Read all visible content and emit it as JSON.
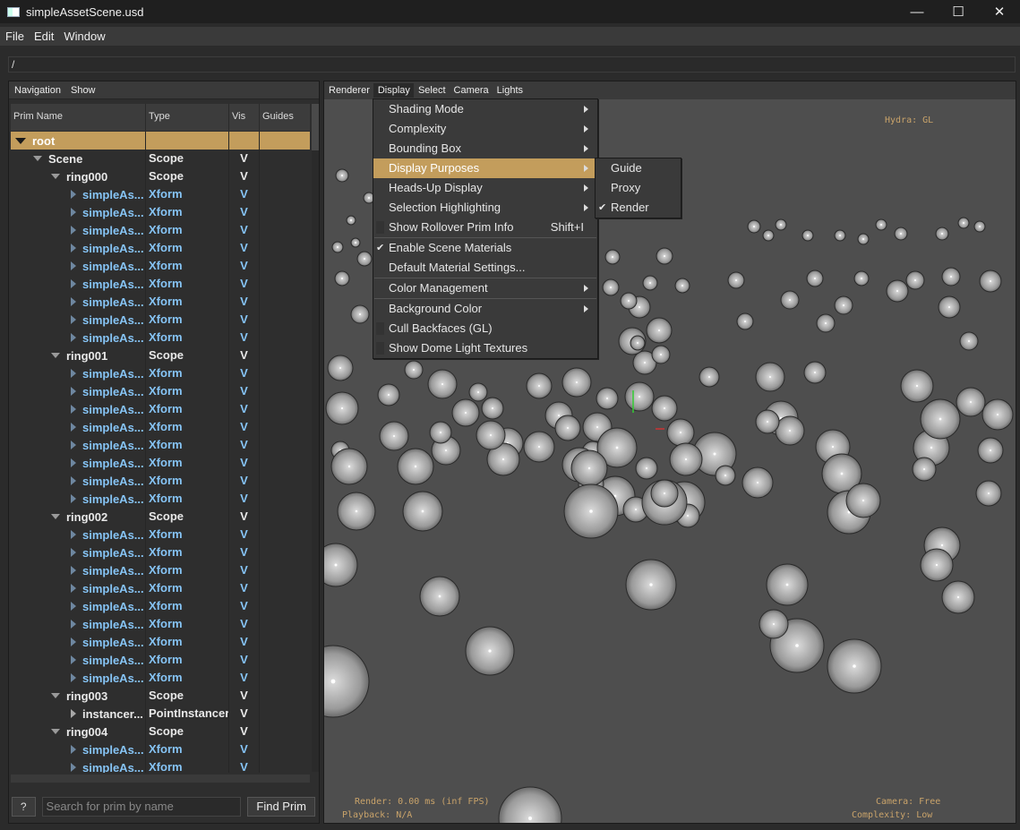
{
  "window": {
    "title": "simpleAssetScene.usd",
    "minimize": "—",
    "maximize": "☐",
    "close": "✕"
  },
  "menubar": [
    "File",
    "Edit",
    "Window"
  ],
  "path": "/",
  "left_menu": [
    "Navigation",
    "Show"
  ],
  "columns": [
    "Prim Name",
    "Type",
    "Vis",
    "Guides"
  ],
  "rows": [
    {
      "name": "root",
      "type": "",
      "vis": "",
      "level": 0,
      "expander": "down",
      "style": "sel"
    },
    {
      "name": "Scene",
      "type": "Scope",
      "vis": "V",
      "level": 1,
      "expander": "down",
      "style": "plain"
    },
    {
      "name": "ring000",
      "type": "Scope",
      "vis": "V",
      "level": 2,
      "expander": "down",
      "style": "plain"
    },
    {
      "name": "simpleAs...",
      "type": "Xform",
      "vis": "V",
      "level": 3,
      "expander": "right",
      "style": "xf"
    },
    {
      "name": "simpleAs...",
      "type": "Xform",
      "vis": "V",
      "level": 3,
      "expander": "right",
      "style": "xf"
    },
    {
      "name": "simpleAs...",
      "type": "Xform",
      "vis": "V",
      "level": 3,
      "expander": "right",
      "style": "xf"
    },
    {
      "name": "simpleAs...",
      "type": "Xform",
      "vis": "V",
      "level": 3,
      "expander": "right",
      "style": "xf"
    },
    {
      "name": "simpleAs...",
      "type": "Xform",
      "vis": "V",
      "level": 3,
      "expander": "right",
      "style": "xf"
    },
    {
      "name": "simpleAs...",
      "type": "Xform",
      "vis": "V",
      "level": 3,
      "expander": "right",
      "style": "xf"
    },
    {
      "name": "simpleAs...",
      "type": "Xform",
      "vis": "V",
      "level": 3,
      "expander": "right",
      "style": "xf"
    },
    {
      "name": "simpleAs...",
      "type": "Xform",
      "vis": "V",
      "level": 3,
      "expander": "right",
      "style": "xf"
    },
    {
      "name": "simpleAs...",
      "type": "Xform",
      "vis": "V",
      "level": 3,
      "expander": "right",
      "style": "xf"
    },
    {
      "name": "ring001",
      "type": "Scope",
      "vis": "V",
      "level": 2,
      "expander": "down",
      "style": "plain"
    },
    {
      "name": "simpleAs...",
      "type": "Xform",
      "vis": "V",
      "level": 3,
      "expander": "right",
      "style": "xf"
    },
    {
      "name": "simpleAs...",
      "type": "Xform",
      "vis": "V",
      "level": 3,
      "expander": "right",
      "style": "xf"
    },
    {
      "name": "simpleAs...",
      "type": "Xform",
      "vis": "V",
      "level": 3,
      "expander": "right",
      "style": "xf"
    },
    {
      "name": "simpleAs...",
      "type": "Xform",
      "vis": "V",
      "level": 3,
      "expander": "right",
      "style": "xf"
    },
    {
      "name": "simpleAs...",
      "type": "Xform",
      "vis": "V",
      "level": 3,
      "expander": "right",
      "style": "xf"
    },
    {
      "name": "simpleAs...",
      "type": "Xform",
      "vis": "V",
      "level": 3,
      "expander": "right",
      "style": "xf"
    },
    {
      "name": "simpleAs...",
      "type": "Xform",
      "vis": "V",
      "level": 3,
      "expander": "right",
      "style": "xf"
    },
    {
      "name": "simpleAs...",
      "type": "Xform",
      "vis": "V",
      "level": 3,
      "expander": "right",
      "style": "xf"
    },
    {
      "name": "ring002",
      "type": "Scope",
      "vis": "V",
      "level": 2,
      "expander": "down",
      "style": "plain"
    },
    {
      "name": "simpleAs...",
      "type": "Xform",
      "vis": "V",
      "level": 3,
      "expander": "right",
      "style": "xf"
    },
    {
      "name": "simpleAs...",
      "type": "Xform",
      "vis": "V",
      "level": 3,
      "expander": "right",
      "style": "xf"
    },
    {
      "name": "simpleAs...",
      "type": "Xform",
      "vis": "V",
      "level": 3,
      "expander": "right",
      "style": "xf"
    },
    {
      "name": "simpleAs...",
      "type": "Xform",
      "vis": "V",
      "level": 3,
      "expander": "right",
      "style": "xf"
    },
    {
      "name": "simpleAs...",
      "type": "Xform",
      "vis": "V",
      "level": 3,
      "expander": "right",
      "style": "xf"
    },
    {
      "name": "simpleAs...",
      "type": "Xform",
      "vis": "V",
      "level": 3,
      "expander": "right",
      "style": "xf"
    },
    {
      "name": "simpleAs...",
      "type": "Xform",
      "vis": "V",
      "level": 3,
      "expander": "right",
      "style": "xf"
    },
    {
      "name": "simpleAs...",
      "type": "Xform",
      "vis": "V",
      "level": 3,
      "expander": "right",
      "style": "xf"
    },
    {
      "name": "simpleAs...",
      "type": "Xform",
      "vis": "V",
      "level": 3,
      "expander": "right",
      "style": "xf"
    },
    {
      "name": "ring003",
      "type": "Scope",
      "vis": "V",
      "level": 2,
      "expander": "down",
      "style": "plain"
    },
    {
      "name": "instancer...",
      "type": "PointInstancer",
      "vis": "V",
      "level": 3,
      "expander": "rightw",
      "style": "plain"
    },
    {
      "name": "ring004",
      "type": "Scope",
      "vis": "V",
      "level": 2,
      "expander": "down",
      "style": "plain"
    },
    {
      "name": "simpleAs...",
      "type": "Xform",
      "vis": "V",
      "level": 3,
      "expander": "right",
      "style": "xf"
    },
    {
      "name": "simpleAs...",
      "type": "Xform",
      "vis": "V",
      "level": 3,
      "expander": "right",
      "style": "xf"
    }
  ],
  "bottom": {
    "help_label": "?",
    "search_placeholder": "Search for prim by name",
    "find_label": "Find Prim"
  },
  "viewport_menu": [
    "Renderer",
    "Display",
    "Select",
    "Camera",
    "Lights"
  ],
  "hud": {
    "renderer": "Hydra: GL",
    "render_time": "Render: 0.00 ms (inf FPS)",
    "playback": "Playback: N/A",
    "camera": "Camera: Free",
    "complexity": "Complexity: Low"
  },
  "display_menu": [
    {
      "label": "Shading Mode",
      "submenu": true
    },
    {
      "label": "Complexity",
      "submenu": true
    },
    {
      "label": "Bounding Box",
      "submenu": true
    },
    {
      "label": "Display Purposes",
      "submenu": true,
      "highlighted": true
    },
    {
      "label": "Heads-Up Display",
      "submenu": true
    },
    {
      "label": "Selection Highlighting",
      "submenu": true
    },
    {
      "label": "Show Rollover Prim Info",
      "shortcut": "Shift+I",
      "checkable": true,
      "checked": false
    },
    {
      "separator": true
    },
    {
      "label": "Enable Scene Materials",
      "checkable": true,
      "checked": true
    },
    {
      "label": "Default Material Settings..."
    },
    {
      "separator": true
    },
    {
      "label": "Color Management",
      "submenu": true
    },
    {
      "separator": true
    },
    {
      "label": "Background Color",
      "submenu": true
    },
    {
      "label": "Cull Backfaces (GL)",
      "checkable": true,
      "checked": false
    },
    {
      "label": "Show Dome Light Textures",
      "checkable": true,
      "checked": false
    }
  ],
  "purposes_menu": [
    {
      "label": "Guide",
      "checked": false
    },
    {
      "label": "Proxy",
      "checked": false
    },
    {
      "label": "Render",
      "checked": true
    }
  ],
  "colors": {
    "accent": "#c39d5c",
    "xform_text": "#86c4f5",
    "hud_text": "#c9a36a",
    "viewport_bg": "#4e4e4e"
  }
}
